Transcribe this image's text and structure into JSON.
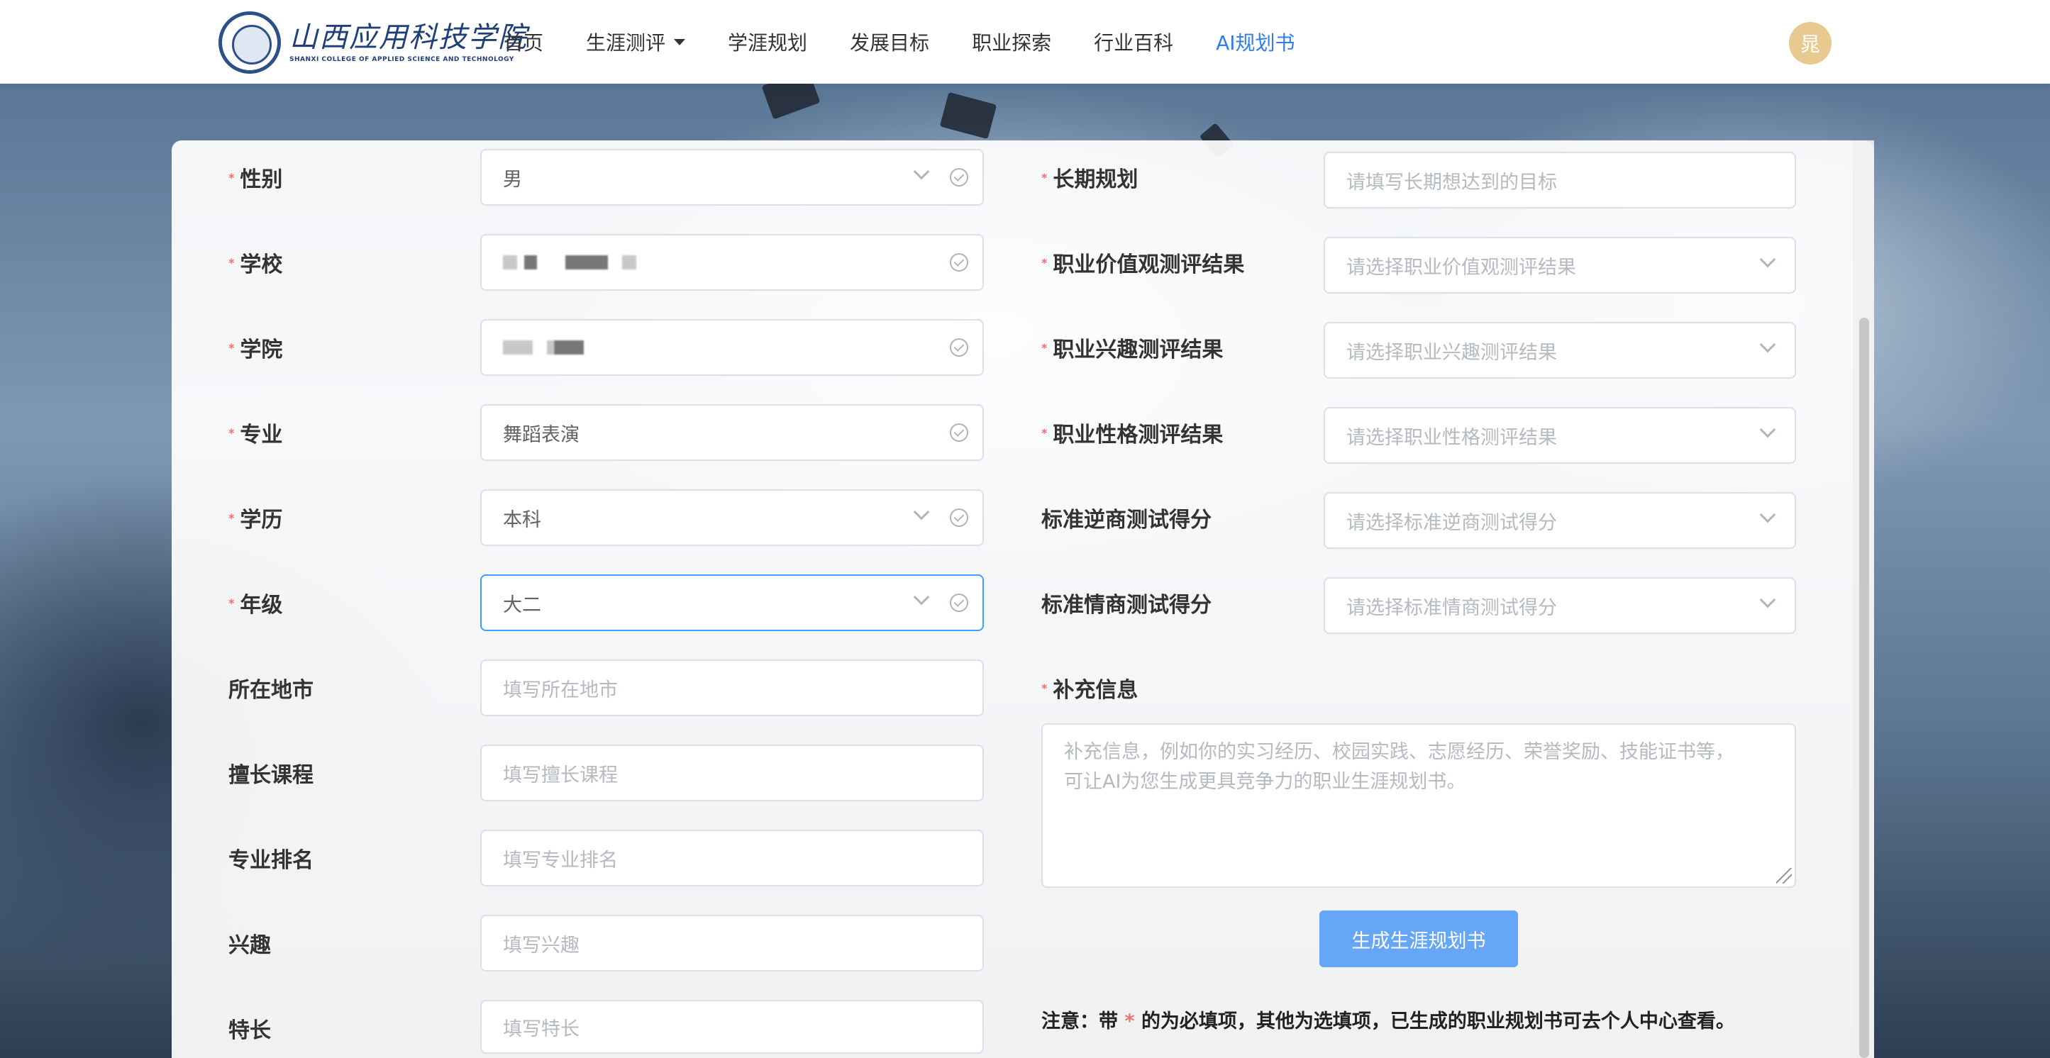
{
  "header": {
    "logo_cn": "山西应用科技学院",
    "logo_en": "SHANXI COLLEGE OF APPLIED SCIENCE AND TECHNOLOGY",
    "nav": [
      "首页",
      "生涯测评",
      "学涯规划",
      "发展目标",
      "职业探索",
      "行业百科",
      "AI规划书"
    ],
    "active_nav": "AI规划书",
    "avatar_text": "晁"
  },
  "form_left": {
    "gender": {
      "label": "性别",
      "value": "男"
    },
    "school": {
      "label": "学校",
      "value": ""
    },
    "college": {
      "label": "学院",
      "value": ""
    },
    "major": {
      "label": "专业",
      "value": "舞蹈表演"
    },
    "education": {
      "label": "学历",
      "value": "本科"
    },
    "grade": {
      "label": "年级",
      "value": "大二"
    },
    "city": {
      "label": "所在地市",
      "placeholder": "填写所在地市"
    },
    "course": {
      "label": "擅长课程",
      "placeholder": "填写擅长课程"
    },
    "ranking": {
      "label": "专业排名",
      "placeholder": "填写专业排名"
    },
    "interest": {
      "label": "兴趣",
      "placeholder": "填写兴趣"
    },
    "specialty": {
      "label": "特长",
      "placeholder": "填写特长"
    }
  },
  "form_right": {
    "long_term": {
      "label": "长期规划",
      "placeholder": "请填写长期想达到的目标"
    },
    "values": {
      "label": "职业价值观测评结果",
      "placeholder": "请选择职业价值观测评结果"
    },
    "interest_result": {
      "label": "职业兴趣测评结果",
      "placeholder": "请选择职业兴趣测评结果"
    },
    "personality": {
      "label": "职业性格测评结果",
      "placeholder": "请选择职业性格测评结果"
    },
    "aq": {
      "label": "标准逆商测试得分",
      "placeholder": "请选择标准逆商测试得分"
    },
    "eq": {
      "label": "标准情商测试得分",
      "placeholder": "请选择标准情商测试得分"
    },
    "extra": {
      "label": "补充信息",
      "placeholder_line1": "补充信息，例如你的实习经历、校园实践、志愿经历、荣誉奖励、技能证书等，",
      "placeholder_line2": "可让AI为您生成更具竞争力的职业生涯规划书。"
    }
  },
  "generate_button": "生成生涯规划书",
  "note": {
    "prefix": "注意：带",
    "star": "*",
    "suffix": "的为必填项，其他为选填项，已生成的职业规划书可去个人中心查看。"
  },
  "required_mark": "*",
  "colors": {
    "accent": "#409eff",
    "required": "#f56c6c",
    "button": "#66a6f7"
  }
}
